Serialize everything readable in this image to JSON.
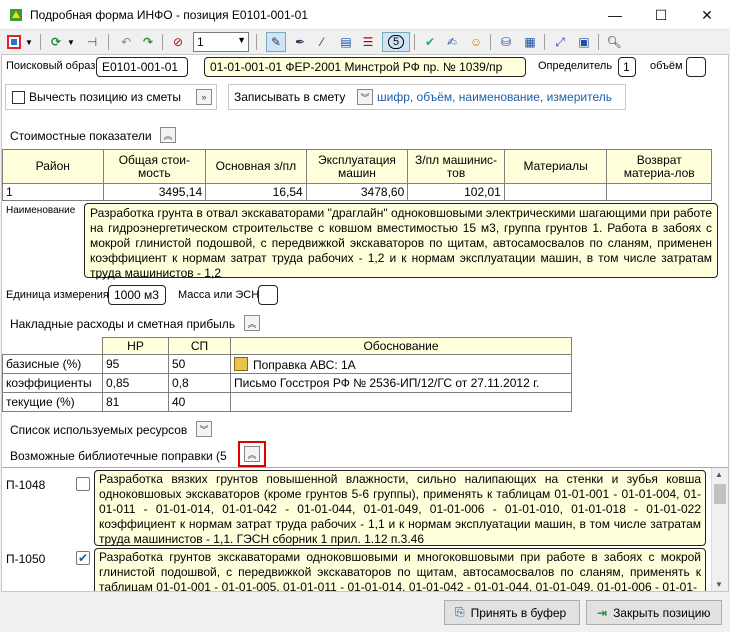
{
  "window": {
    "title": "Подробная форма ИНФО - позиция Е0101-001-01",
    "minimize": "—",
    "maximize": "☐",
    "close": "✕"
  },
  "toolbar": {
    "combo_value": "1",
    "counter": "5"
  },
  "search": {
    "label": "Поисковый образ",
    "value": "Е0101-001-01",
    "source": "01-01-001-01 ФЕР-2001 Минстрой РФ пр. № 1039/пр",
    "determinant_label": "Определитель",
    "determinant_value": "1",
    "volume_label": "объём",
    "volume_value": ""
  },
  "subtract": {
    "label": "Вычесть позицию из сметы",
    "button": "»",
    "write_label": "Записывать в смету",
    "write_value": "шифр, объём, наименование, измеритель"
  },
  "costs": {
    "section_label": "Стоимостные показатели",
    "headers": [
      "Район",
      "Общая стои-мость",
      "Основная з/пл",
      "Эксплуатация машин",
      "З/пл машинис-тов",
      "Материалы",
      "Возврат материа-лов"
    ],
    "row": [
      "1",
      "3495,14",
      "16,54",
      "3478,60",
      "102,01",
      "",
      ""
    ]
  },
  "name": {
    "label": "Наименование",
    "text": "Разработка грунта в отвал экскаваторами \"драглайн\" одноковшовыми электрическими шагающими при работе на гидроэнергетическом строительстве с ковшом вместимостью 15 м3, группа грунтов 1. Работа в забоях с мокрой глинистой подошвой, с передвижкой экскаваторов по щитам, автосамосвалов по слaням, применен коэффициент к нормам затрат труда рабочих - 1,2 и к нормам эксплуатации машин, в том числе затратам труда машинистов - 1,2"
  },
  "unit": {
    "label": "Единица измерения",
    "value": "1000 м3",
    "mass_label": "Масса или ЭСН",
    "mass_value": ""
  },
  "overhead": {
    "section_label": "Накладные расходы и сметная прибыль",
    "headers": [
      "",
      "НР",
      "СП",
      "Обоснование"
    ],
    "rows": [
      {
        "label": "базисные (%)",
        "nr": "95",
        "sp": "50",
        "reason": "Поправка АВС: 1А"
      },
      {
        "label": "коэффициенты",
        "nr": "0,85",
        "sp": "0,8",
        "reason": "Письмо Госстроя РФ № 2536-ИП/12/ГС от 27.11.2012 г."
      },
      {
        "label": "текущие (%)",
        "nr": "81",
        "sp": "40",
        "reason": ""
      }
    ]
  },
  "resources": {
    "section_label": "Список используемых ресурсов"
  },
  "library": {
    "section_label": "Возможные библиотечные поправки (5",
    "items": [
      {
        "code": "П-1048",
        "checked": false,
        "text": "Разработка вязких грунтов повышенной влажности, сильно налипающих на стенки и зубья ковша одноковшовых экскаваторов (кроме грунтов 5-6 группы), применять к таблицам 01-01-001 - 01-01-004, 01-01-011 - 01-01-014, 01-01-042 - 01-01-044, 01-01-049, 01-01-006 - 01-01-010, 01-01-018 - 01-01-022 коэффициент к нормам затрат труда рабочих - 1,1 и к нормам эксплуатации машин, в том числе затратам труда машинистов - 1,1. ГЭСН сборник 1 прил. 1.12 п.3.46"
      },
      {
        "code": "П-1050",
        "checked": true,
        "text": "Разработка грунтов экскаваторами одноковшовыми и многоковшовыми при работе в забоях с мокрой глинистой подошвой, с передвижкой экскаваторов по щитам, автосамосвалов по слaням, применять к таблицам 01-01-001 - 01-01-005, 01-01-011 - 01-01-014, 01-01-042 - 01-01-044, 01-01-049, 01-01-006 - 01-01-"
      }
    ]
  },
  "footer": {
    "accept_button": "Принять в буфер",
    "close_button": "Закрыть позицию"
  },
  "colors": {
    "yellow_field": "#ffffdc",
    "highlight_red": "#e00000"
  }
}
